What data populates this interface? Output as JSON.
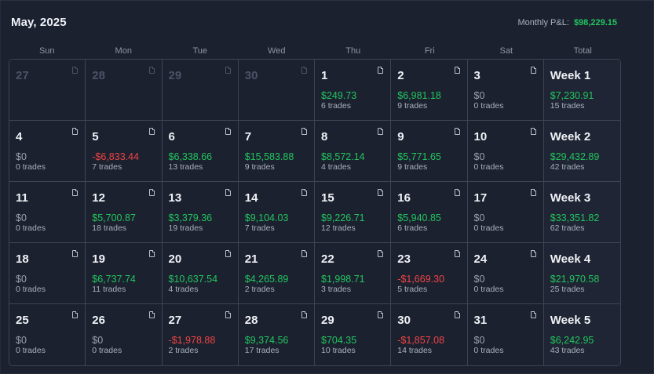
{
  "header": {
    "title": "May, 2025",
    "pnl_label": "Monthly P&L:",
    "pnl_value": "$98,229.15"
  },
  "weekdays": [
    "Sun",
    "Mon",
    "Tue",
    "Wed",
    "Thu",
    "Fri",
    "Sat",
    "Total"
  ],
  "weeks": [
    {
      "days": [
        {
          "day": "27",
          "muted": true
        },
        {
          "day": "28",
          "muted": true
        },
        {
          "day": "29",
          "muted": true
        },
        {
          "day": "30",
          "muted": true
        },
        {
          "day": "1",
          "pnl": "$249.73",
          "trades": "6 trades",
          "sign": "pos"
        },
        {
          "day": "2",
          "pnl": "$6,981.18",
          "trades": "9 trades",
          "sign": "pos"
        },
        {
          "day": "3",
          "pnl": "$0",
          "trades": "0 trades",
          "sign": "zero"
        }
      ],
      "total": {
        "label": "Week 1",
        "pnl": "$7,230.91",
        "trades": "15 trades",
        "sign": "pos"
      }
    },
    {
      "days": [
        {
          "day": "4",
          "pnl": "$0",
          "trades": "0 trades",
          "sign": "zero"
        },
        {
          "day": "5",
          "pnl": "-$6,833.44",
          "trades": "7 trades",
          "sign": "neg"
        },
        {
          "day": "6",
          "pnl": "$6,338.66",
          "trades": "13 trades",
          "sign": "pos"
        },
        {
          "day": "7",
          "pnl": "$15,583.88",
          "trades": "9 trades",
          "sign": "pos"
        },
        {
          "day": "8",
          "pnl": "$8,572.14",
          "trades": "4 trades",
          "sign": "pos"
        },
        {
          "day": "9",
          "pnl": "$5,771.65",
          "trades": "9 trades",
          "sign": "pos"
        },
        {
          "day": "10",
          "pnl": "$0",
          "trades": "0 trades",
          "sign": "zero"
        }
      ],
      "total": {
        "label": "Week 2",
        "pnl": "$29,432.89",
        "trades": "42 trades",
        "sign": "pos"
      }
    },
    {
      "days": [
        {
          "day": "11",
          "pnl": "$0",
          "trades": "0 trades",
          "sign": "zero"
        },
        {
          "day": "12",
          "pnl": "$5,700.87",
          "trades": "18 trades",
          "sign": "pos"
        },
        {
          "day": "13",
          "pnl": "$3,379.36",
          "trades": "19 trades",
          "sign": "pos"
        },
        {
          "day": "14",
          "pnl": "$9,104.03",
          "trades": "7 trades",
          "sign": "pos"
        },
        {
          "day": "15",
          "pnl": "$9,226.71",
          "trades": "12 trades",
          "sign": "pos"
        },
        {
          "day": "16",
          "pnl": "$5,940.85",
          "trades": "6 trades",
          "sign": "pos"
        },
        {
          "day": "17",
          "pnl": "$0",
          "trades": "0 trades",
          "sign": "zero"
        }
      ],
      "total": {
        "label": "Week 3",
        "pnl": "$33,351.82",
        "trades": "62 trades",
        "sign": "pos"
      }
    },
    {
      "days": [
        {
          "day": "18",
          "pnl": "$0",
          "trades": "0 trades",
          "sign": "zero"
        },
        {
          "day": "19",
          "pnl": "$6,737.74",
          "trades": "11 trades",
          "sign": "pos"
        },
        {
          "day": "20",
          "pnl": "$10,637.54",
          "trades": "4 trades",
          "sign": "pos"
        },
        {
          "day": "21",
          "pnl": "$4,265.89",
          "trades": "2 trades",
          "sign": "pos"
        },
        {
          "day": "22",
          "pnl": "$1,998.71",
          "trades": "3 trades",
          "sign": "pos"
        },
        {
          "day": "23",
          "pnl": "-$1,669.30",
          "trades": "5 trades",
          "sign": "neg"
        },
        {
          "day": "24",
          "pnl": "$0",
          "trades": "0 trades",
          "sign": "zero"
        }
      ],
      "total": {
        "label": "Week 4",
        "pnl": "$21,970.58",
        "trades": "25 trades",
        "sign": "pos"
      }
    },
    {
      "days": [
        {
          "day": "25",
          "pnl": "$0",
          "trades": "0 trades",
          "sign": "zero"
        },
        {
          "day": "26",
          "pnl": "$0",
          "trades": "0 trades",
          "sign": "zero"
        },
        {
          "day": "27",
          "pnl": "-$1,978.88",
          "trades": "2 trades",
          "sign": "neg"
        },
        {
          "day": "28",
          "pnl": "$9,374.56",
          "trades": "17 trades",
          "sign": "pos"
        },
        {
          "day": "29",
          "pnl": "$704.35",
          "trades": "10 trades",
          "sign": "pos"
        },
        {
          "day": "30",
          "pnl": "-$1,857.08",
          "trades": "14 trades",
          "sign": "neg"
        },
        {
          "day": "31",
          "pnl": "$0",
          "trades": "0 trades",
          "sign": "zero"
        }
      ],
      "total": {
        "label": "Week 5",
        "pnl": "$6,242.95",
        "trades": "43 trades",
        "sign": "pos"
      }
    }
  ],
  "colors": {
    "positive": "#22c55e",
    "negative": "#ef4444",
    "neutral": "#9aa1ad",
    "background": "#1c2130"
  },
  "icons": {
    "day_note": "document-icon"
  }
}
